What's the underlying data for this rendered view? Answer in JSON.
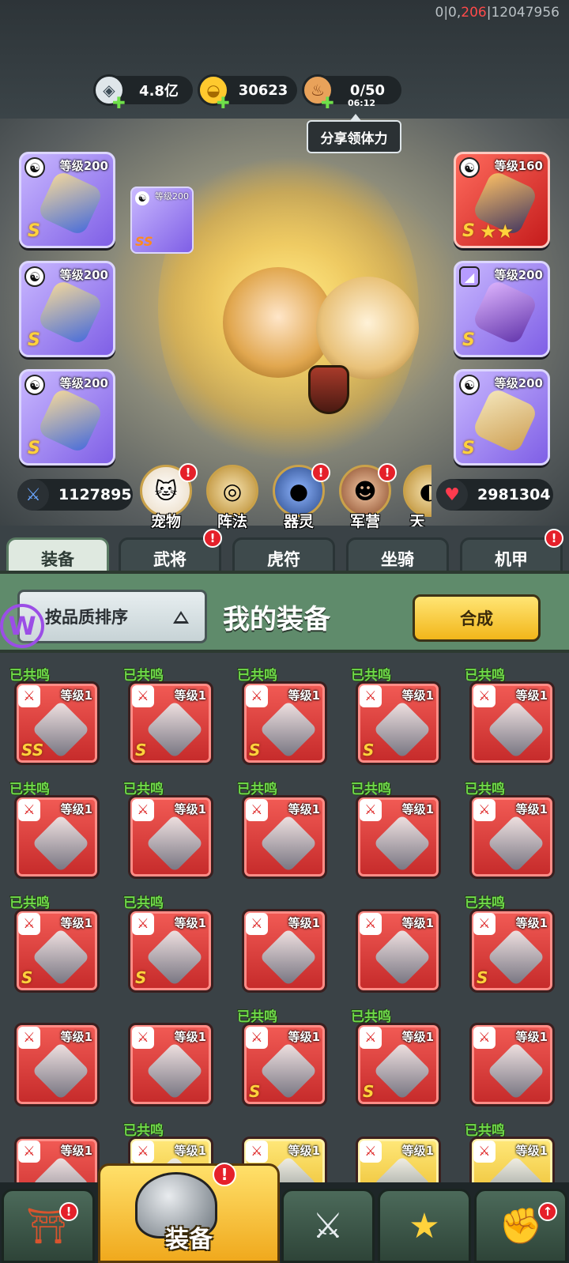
{
  "debug": {
    "prefix": "0|0,",
    "highlight": "206",
    "suffix": "|12047956"
  },
  "resources": [
    {
      "icon": "silver-coin-icon",
      "value": "4.8亿"
    },
    {
      "icon": "gold-ingot-icon",
      "value": "30623"
    },
    {
      "icon": "meat-icon",
      "value": "0/50",
      "timer": "06:12"
    }
  ],
  "share_label": "分享领体力",
  "slots": [
    {
      "level": "等级200",
      "grade": "S",
      "color": "purple"
    },
    {
      "level": "等级200",
      "grade": "S",
      "color": "purple"
    },
    {
      "level": "等级200",
      "grade": "S",
      "color": "purple"
    },
    {
      "level": "等级160",
      "grade": "S",
      "color": "red"
    },
    {
      "level": "等级200",
      "grade": "S",
      "color": "purple"
    },
    {
      "level": "等级200",
      "grade": "S",
      "color": "purple"
    }
  ],
  "mini_slot": {
    "level": "等级200",
    "grade": "SS"
  },
  "power": "1127895",
  "hp": "2981304",
  "functions": [
    "宠物",
    "阵法",
    "器灵",
    "军营",
    "天"
  ],
  "tabs": [
    "装备",
    "武将",
    "虎符",
    "坐骑",
    "机甲"
  ],
  "panel": {
    "sort_label": "按品质排序",
    "title": "我的装备",
    "combine_label": "合成"
  },
  "resonance_label": "已共鸣",
  "level_label": "等级1",
  "grid": [
    [
      {
        "r": true,
        "g": "SS",
        "gold": false
      },
      {
        "r": true,
        "g": "S",
        "gold": false
      },
      {
        "r": true,
        "g": "S",
        "gold": false
      },
      {
        "r": true,
        "g": "S",
        "gold": false
      },
      {
        "r": true,
        "g": "",
        "gold": false
      }
    ],
    [
      {
        "r": true,
        "g": "",
        "gold": false
      },
      {
        "r": true,
        "g": "",
        "gold": false
      },
      {
        "r": true,
        "g": "",
        "gold": false
      },
      {
        "r": true,
        "g": "",
        "gold": false
      },
      {
        "r": true,
        "g": "",
        "gold": false
      }
    ],
    [
      {
        "r": true,
        "g": "S",
        "gold": false
      },
      {
        "r": true,
        "g": "S",
        "gold": false
      },
      {
        "r": false,
        "g": "",
        "gold": false
      },
      {
        "r": false,
        "g": "",
        "gold": false
      },
      {
        "r": true,
        "g": "S",
        "gold": false
      }
    ],
    [
      {
        "r": false,
        "g": "",
        "gold": false
      },
      {
        "r": false,
        "g": "",
        "gold": false
      },
      {
        "r": true,
        "g": "S",
        "gold": false
      },
      {
        "r": true,
        "g": "S",
        "gold": false
      },
      {
        "r": false,
        "g": "",
        "gold": false
      }
    ],
    [
      {
        "r": false,
        "g": "",
        "gold": false
      },
      {
        "r": true,
        "g": "",
        "gold": true
      },
      {
        "r": false,
        "g": "",
        "gold": true
      },
      {
        "r": false,
        "g": "",
        "gold": true
      },
      {
        "r": true,
        "g": "",
        "gold": true
      }
    ]
  ],
  "bottom_nav": {
    "active_label": "装备"
  }
}
